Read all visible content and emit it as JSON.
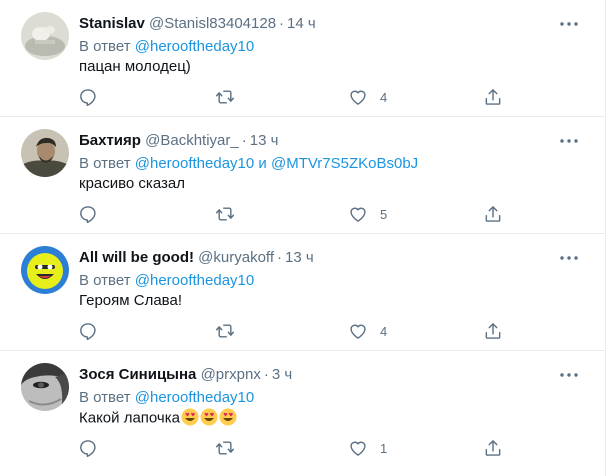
{
  "reply_prefix": "В ответ",
  "reply_joiner": "и",
  "tweets": [
    {
      "name": "Stanislav",
      "handle": "@Stanisl83404128",
      "dot": "·",
      "time": "14 ч",
      "mention1": "@herooftheday10",
      "text": "пацан молодец)",
      "likes": "4",
      "icons": [
        "reply-icon",
        "retweet-icon",
        "heart-icon",
        "share-icon"
      ]
    },
    {
      "name": "Бахтияр",
      "handle": "@Backhtiyar_",
      "dot": "·",
      "time": "13 ч",
      "mention1": "@herooftheday10",
      "mention2": "@MTVr7S5ZKoBs0bJ",
      "text": "красиво сказал",
      "likes": "5"
    },
    {
      "name": "All will be good!",
      "handle": "@kuryakoff",
      "dot": "·",
      "time": "13 ч",
      "mention1": "@herooftheday10",
      "text": "Героям Слава!",
      "likes": "4"
    },
    {
      "name": "Зося Синицына",
      "handle": "@prxpnx",
      "dot": "·",
      "time": "3 ч",
      "mention1": "@herooftheday10",
      "text": "Какой лапочка",
      "emojis": "😍😍😍",
      "likes": "1"
    }
  ],
  "colors": {
    "accent": "#1b95e0",
    "secondary_text": "#5b7083",
    "divider": "#e6ecf0"
  }
}
